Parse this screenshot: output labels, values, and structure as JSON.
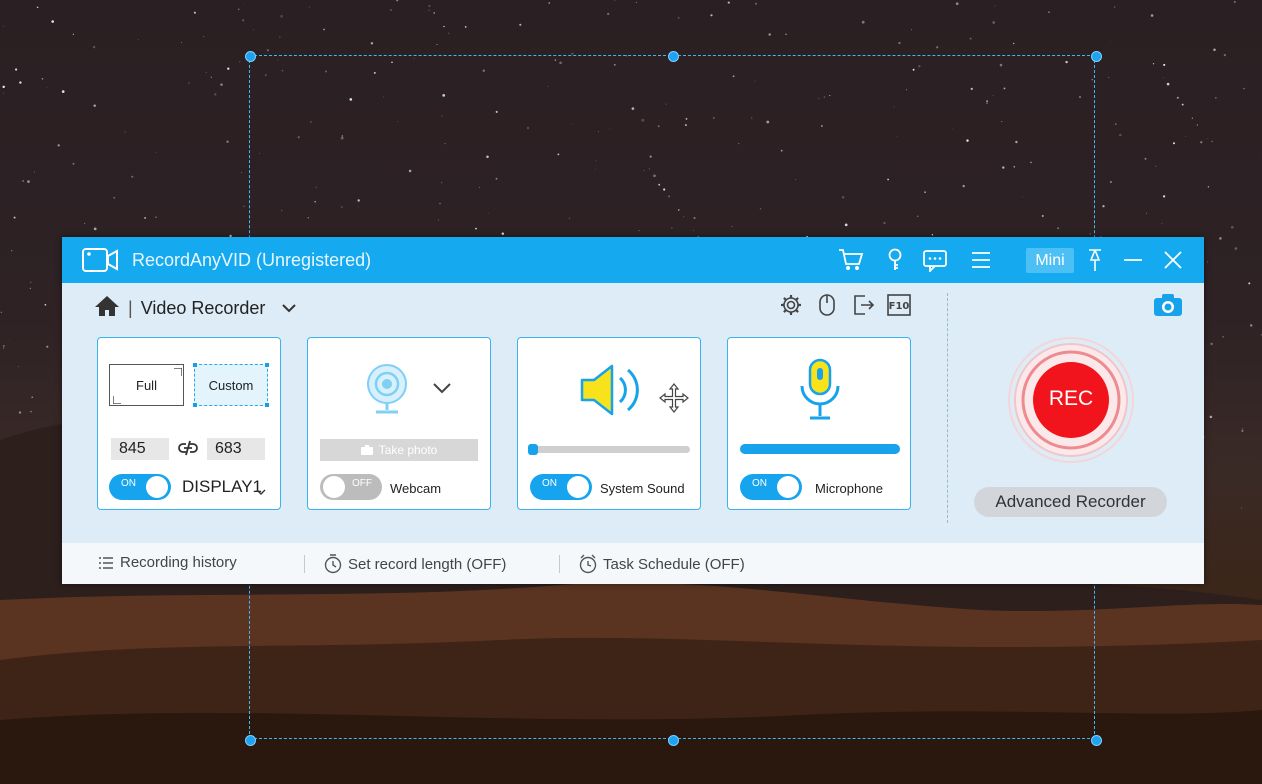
{
  "app": {
    "title": "RecordAnyVID (Unregistered)",
    "mini_label": "Mini",
    "mode": "Video Recorder"
  },
  "region": {
    "full_label": "Full",
    "custom_label": "Custom",
    "width": "845",
    "height": "683",
    "toggle": "ON",
    "display": "DISPLAY1"
  },
  "webcam": {
    "take_photo": "Take photo",
    "toggle": "OFF",
    "label": "Webcam"
  },
  "system_sound": {
    "toggle": "ON",
    "label": "System Sound",
    "level": 0.02
  },
  "microphone": {
    "toggle": "ON",
    "label": "Microphone",
    "level": 1.0
  },
  "rec_label": "REC",
  "advanced_recorder": "Advanced Recorder",
  "footer": {
    "history": "Recording history",
    "record_length": "Set record length (OFF)",
    "task_schedule": "Task Schedule (OFF)"
  },
  "colors": {
    "accent": "#15a9ef",
    "rec_red": "#f2141c",
    "icon_yellow": "#f7e21c"
  }
}
